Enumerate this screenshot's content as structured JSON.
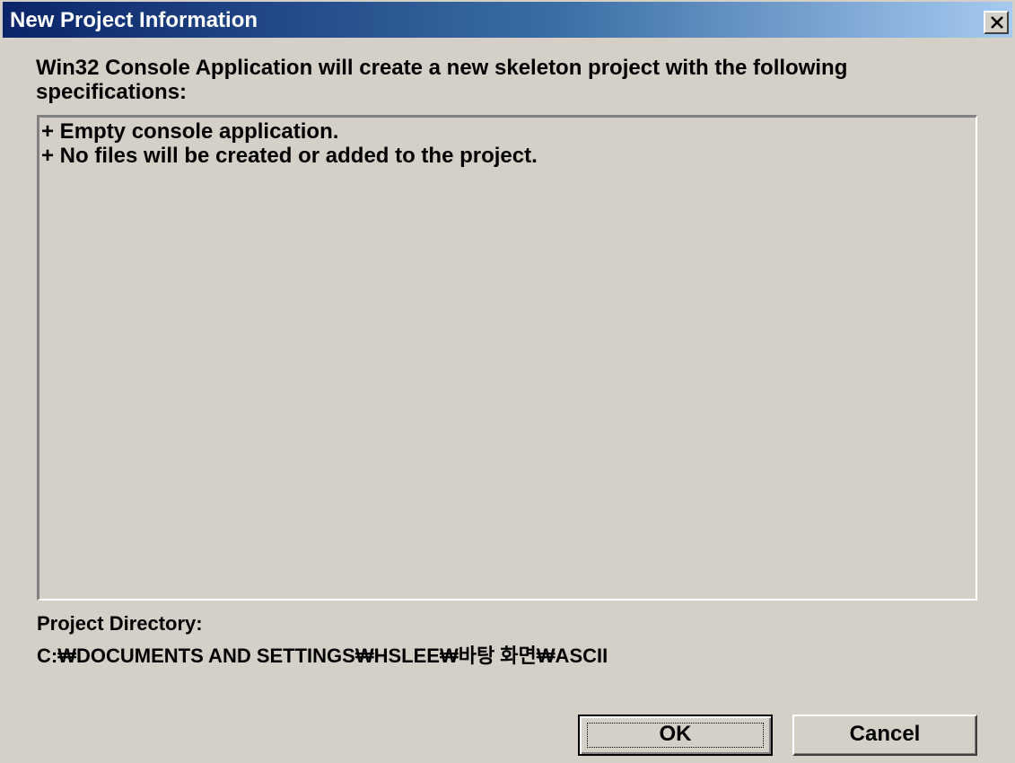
{
  "window": {
    "title": "New Project Information",
    "close_icon": "close-icon"
  },
  "intro_text": "Win32 Console Application will create a new skeleton project with the following specifications:",
  "specifications": [
    "+ Empty console application.",
    "+ No files will be created or added to the project."
  ],
  "project_directory": {
    "label": "Project Directory:",
    "value": "C:₩DOCUMENTS AND SETTINGS₩HSLEE₩바탕 화면₩ASCII"
  },
  "buttons": {
    "ok_label": "OK",
    "cancel_label": "Cancel"
  },
  "colors": {
    "title_bar_start": "#0a246a",
    "title_bar_end": "#a6caf0",
    "dialog_face": "#d4d0c8"
  }
}
